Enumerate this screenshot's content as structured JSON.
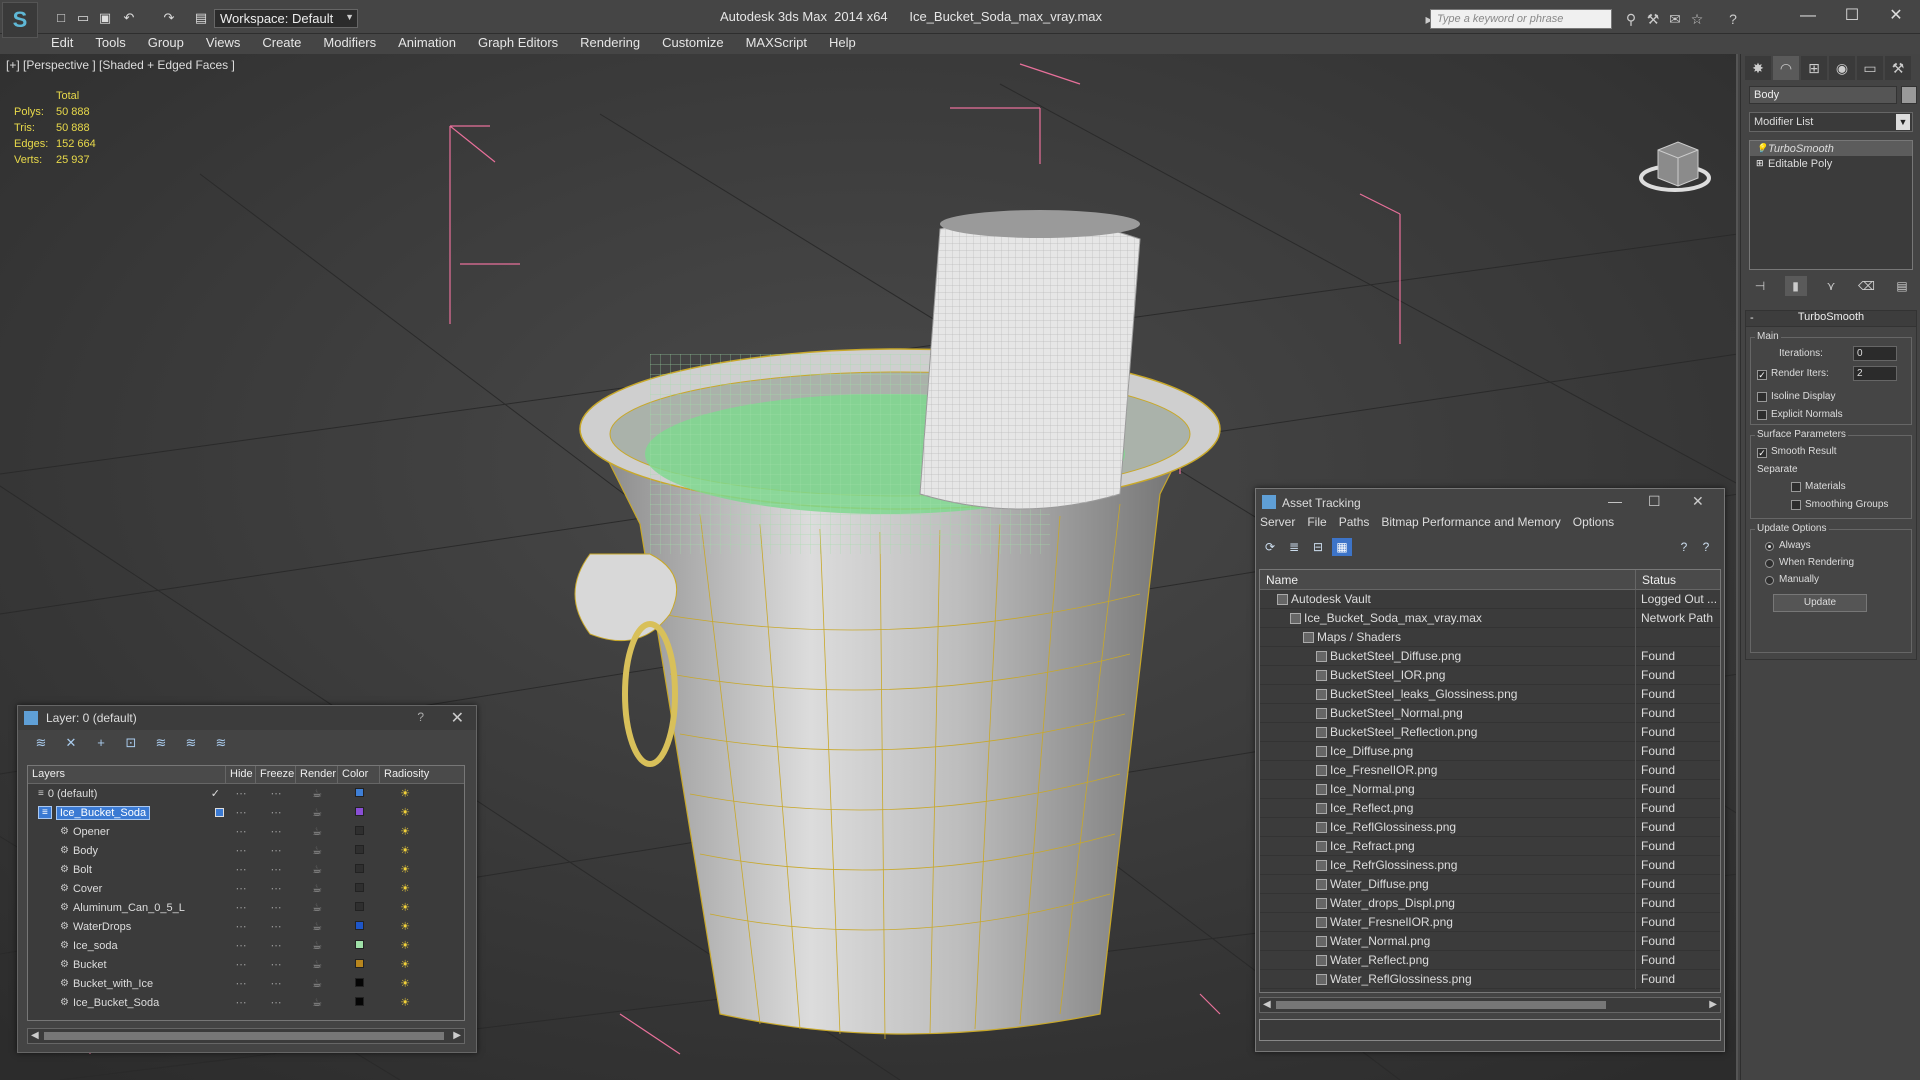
{
  "app": {
    "title": "Autodesk 3ds Max  2014 x64      Ice_Bucket_Soda_max_vray.max",
    "workspace": "Workspace: Default",
    "search_placeholder": "Type a keyword or phrase"
  },
  "menu": [
    "Edit",
    "Tools",
    "Group",
    "Views",
    "Create",
    "Modifiers",
    "Animation",
    "Graph Editors",
    "Rendering",
    "Customize",
    "MAXScript",
    "Help"
  ],
  "viewport": {
    "label": "[+] [Perspective ] [Shaded + Edged Faces ]",
    "stats": {
      "header": "Total",
      "rows": [
        {
          "k": "Polys:",
          "v": "50 888"
        },
        {
          "k": "Tris:",
          "v": "50 888"
        },
        {
          "k": "Edges:",
          "v": "152 664"
        },
        {
          "k": "Verts:",
          "v": "25 937"
        }
      ]
    }
  },
  "command_panel": {
    "object_name": "Body",
    "modifier_list": "Modifier List",
    "stack": [
      "TurboSmooth",
      "Editable Poly"
    ],
    "turbosmooth": {
      "title": "TurboSmooth",
      "main_label": "Main",
      "iterations_label": "Iterations:",
      "iterations_value": "0",
      "render_iters_label": "Render Iters:",
      "render_iters_value": "2",
      "isoline": "Isoline Display",
      "explicit": "Explicit Normals",
      "surface_params": "Surface Parameters",
      "smooth_result": "Smooth Result",
      "separate": "Separate",
      "materials": "Materials",
      "smoothing_groups": "Smoothing Groups",
      "update_options": "Update Options",
      "always": "Always",
      "when_rendering": "When Rendering",
      "manually": "Manually",
      "update_btn": "Update"
    }
  },
  "layer_dialog": {
    "title": "Layer: 0 (default)",
    "help": "?",
    "columns": [
      "Layers",
      "Hide",
      "Freeze",
      "Render",
      "Color",
      "Radiosity"
    ],
    "rows": [
      {
        "name": "0 (default)",
        "color": "#3f7fd6",
        "indent": 0,
        "checked": true
      },
      {
        "name": "Ice_Bucket_Soda",
        "color": "#8a4fd6",
        "indent": 0,
        "selected": true
      },
      {
        "name": "Opener",
        "color": "#2f2f2f",
        "indent": 1
      },
      {
        "name": "Body",
        "color": "#2f2f2f",
        "indent": 1
      },
      {
        "name": "Bolt",
        "color": "#2f2f2f",
        "indent": 1
      },
      {
        "name": "Cover",
        "color": "#2f2f2f",
        "indent": 1
      },
      {
        "name": "Aluminum_Can_0_5_L",
        "color": "#2f2f2f",
        "indent": 1
      },
      {
        "name": "WaterDrops",
        "color": "#1e56c8",
        "indent": 1
      },
      {
        "name": "Ice_soda",
        "color": "#9fe0a8",
        "indent": 1
      },
      {
        "name": "Bucket",
        "color": "#b8861e",
        "indent": 1
      },
      {
        "name": "Bucket_with_Ice",
        "color": "#050505",
        "indent": 1
      },
      {
        "name": "Ice_Bucket_Soda",
        "color": "#050505",
        "indent": 1
      }
    ]
  },
  "asset_dialog": {
    "title": "Asset Tracking",
    "menu": [
      "Server",
      "File",
      "Paths",
      "Bitmap Performance and Memory",
      "Options"
    ],
    "columns": [
      "Name",
      "Status"
    ],
    "rows": [
      {
        "name": "Autodesk Vault",
        "status": "Logged Out ...",
        "indent": 1
      },
      {
        "name": "Ice_Bucket_Soda_max_vray.max",
        "status": "Network Path",
        "indent": 2
      },
      {
        "name": "Maps / Shaders",
        "status": "",
        "indent": 3
      },
      {
        "name": "BucketSteel_Diffuse.png",
        "status": "Found",
        "indent": 4
      },
      {
        "name": "BucketSteel_IOR.png",
        "status": "Found",
        "indent": 4
      },
      {
        "name": "BucketSteel_leaks_Glossiness.png",
        "status": "Found",
        "indent": 4
      },
      {
        "name": "BucketSteel_Normal.png",
        "status": "Found",
        "indent": 4
      },
      {
        "name": "BucketSteel_Reflection.png",
        "status": "Found",
        "indent": 4
      },
      {
        "name": "Ice_Diffuse.png",
        "status": "Found",
        "indent": 4
      },
      {
        "name": "Ice_FresnelIOR.png",
        "status": "Found",
        "indent": 4
      },
      {
        "name": "Ice_Normal.png",
        "status": "Found",
        "indent": 4
      },
      {
        "name": "Ice_Reflect.png",
        "status": "Found",
        "indent": 4
      },
      {
        "name": "Ice_ReflGlossiness.png",
        "status": "Found",
        "indent": 4
      },
      {
        "name": "Ice_Refract.png",
        "status": "Found",
        "indent": 4
      },
      {
        "name": "Ice_RefrGlossiness.png",
        "status": "Found",
        "indent": 4
      },
      {
        "name": "Water_Diffuse.png",
        "status": "Found",
        "indent": 4
      },
      {
        "name": "Water_drops_Displ.png",
        "status": "Found",
        "indent": 4
      },
      {
        "name": "Water_FresnelIOR.png",
        "status": "Found",
        "indent": 4
      },
      {
        "name": "Water_Normal.png",
        "status": "Found",
        "indent": 4
      },
      {
        "name": "Water_Reflect.png",
        "status": "Found",
        "indent": 4
      },
      {
        "name": "Water_ReflGlossiness.png",
        "status": "Found",
        "indent": 4
      }
    ]
  }
}
